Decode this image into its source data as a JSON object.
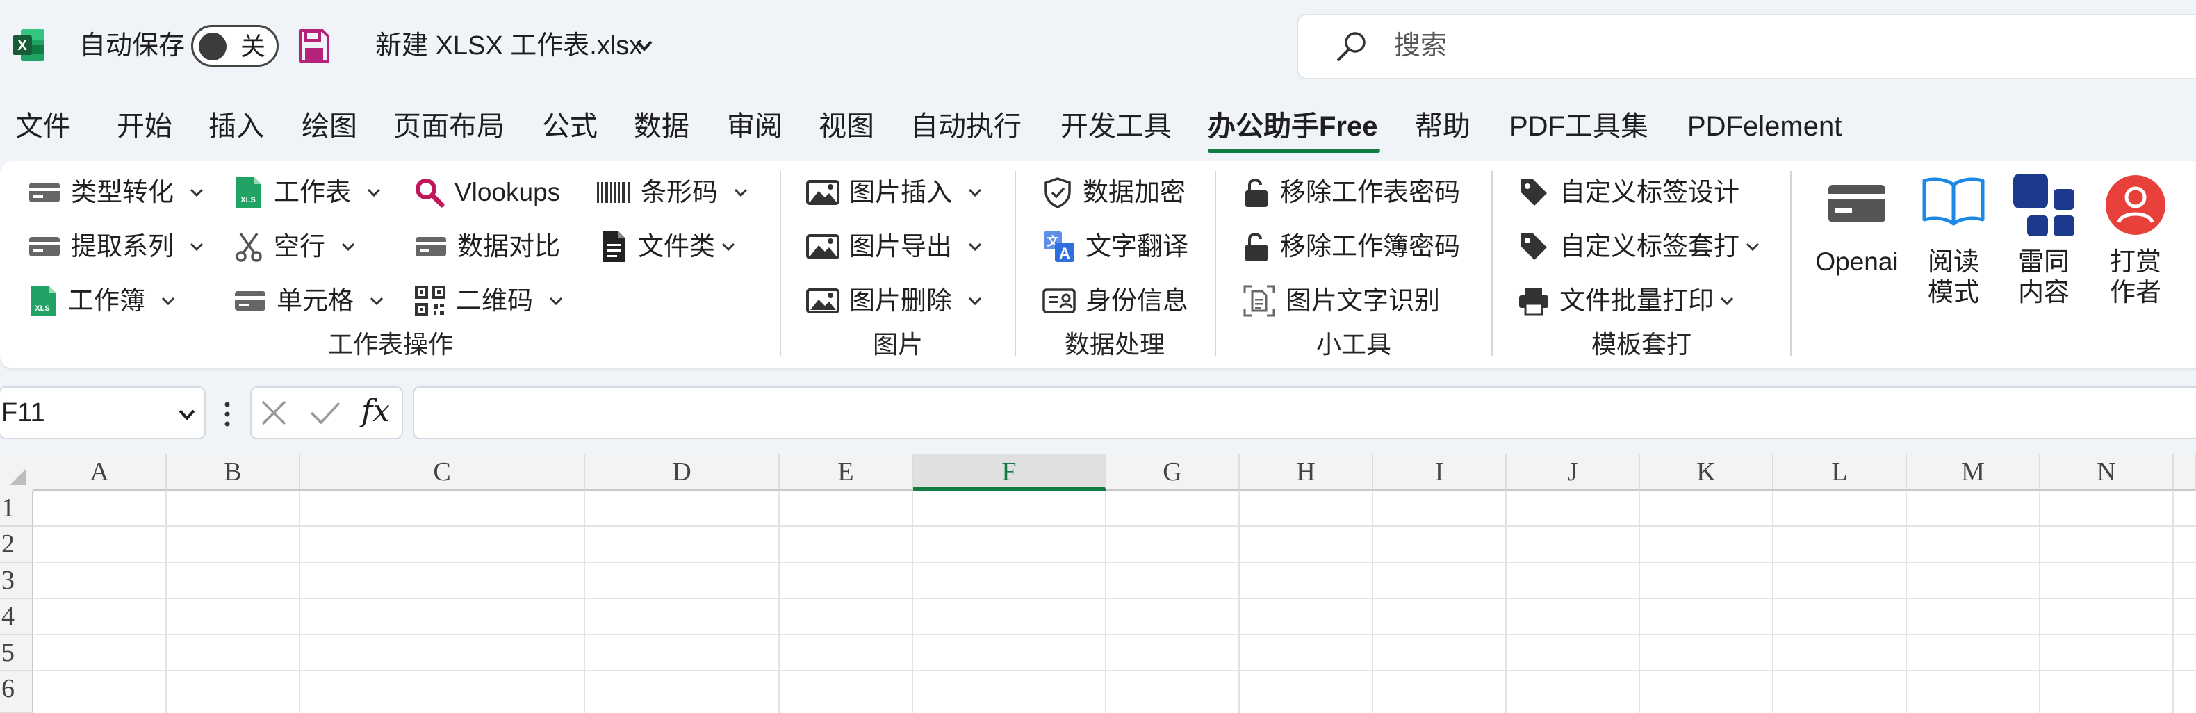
{
  "title_bar": {
    "app_icon_letter": "X",
    "autosave_label": "自动保存",
    "autosave_state": "关",
    "filename": "新建 XLSX 工作表.xlsx",
    "search_placeholder": "搜索"
  },
  "menu": {
    "tabs": [
      "文件",
      "开始",
      "插入",
      "绘图",
      "页面布局",
      "公式",
      "数据",
      "审阅",
      "视图",
      "自动执行",
      "开发工具",
      "办公助手Free",
      "帮助",
      "PDF工具集",
      "PDFelement"
    ],
    "active_tab": "办公助手Free"
  },
  "ribbon": {
    "worksheet_ops": {
      "label": "工作表操作",
      "buttons": [
        "类型转化",
        "工作表",
        "Vlookups",
        "条形码",
        "提取系列",
        "空行",
        "数据对比",
        "文件类",
        "工作簿",
        "单元格",
        "二维码"
      ],
      "xls_icon_text": "XLS"
    },
    "images": {
      "label": "图片",
      "buttons": [
        "图片插入",
        "图片导出",
        "图片删除"
      ]
    },
    "data_processing": {
      "label": "数据处理",
      "buttons": [
        "数据加密",
        "文字翻译",
        "身份信息"
      ]
    },
    "small_tools": {
      "label": "小工具",
      "buttons": [
        "移除工作表密码",
        "移除工作簿密码",
        "图片文字识别"
      ]
    },
    "template_print": {
      "label": "模板套打",
      "buttons": [
        "自定义标签设计",
        "自定义标签套打",
        "文件批量打印"
      ]
    },
    "big_buttons": [
      {
        "line1": "Openai",
        "line2": ""
      },
      {
        "line1": "阅读",
        "line2": "模式"
      },
      {
        "line1": "雷同",
        "line2": "内容"
      },
      {
        "line1": "打赏",
        "line2": "作者"
      }
    ]
  },
  "formula_bar": {
    "name_box": "F11",
    "fx": "fx",
    "formula": ""
  },
  "grid": {
    "columns": [
      "A",
      "B",
      "C",
      "D",
      "E",
      "F",
      "G",
      "H",
      "I",
      "J",
      "K",
      "L",
      "M",
      "N"
    ],
    "rows": [
      "1",
      "2",
      "3",
      "4",
      "5",
      "6"
    ],
    "selected_column": "F"
  },
  "colors": {
    "excel_green": "#107c41",
    "accent_purple": "#b4227a",
    "navy": "#1b3a8c",
    "red": "#e8413b",
    "translate_blue": "#2f6fdd"
  }
}
